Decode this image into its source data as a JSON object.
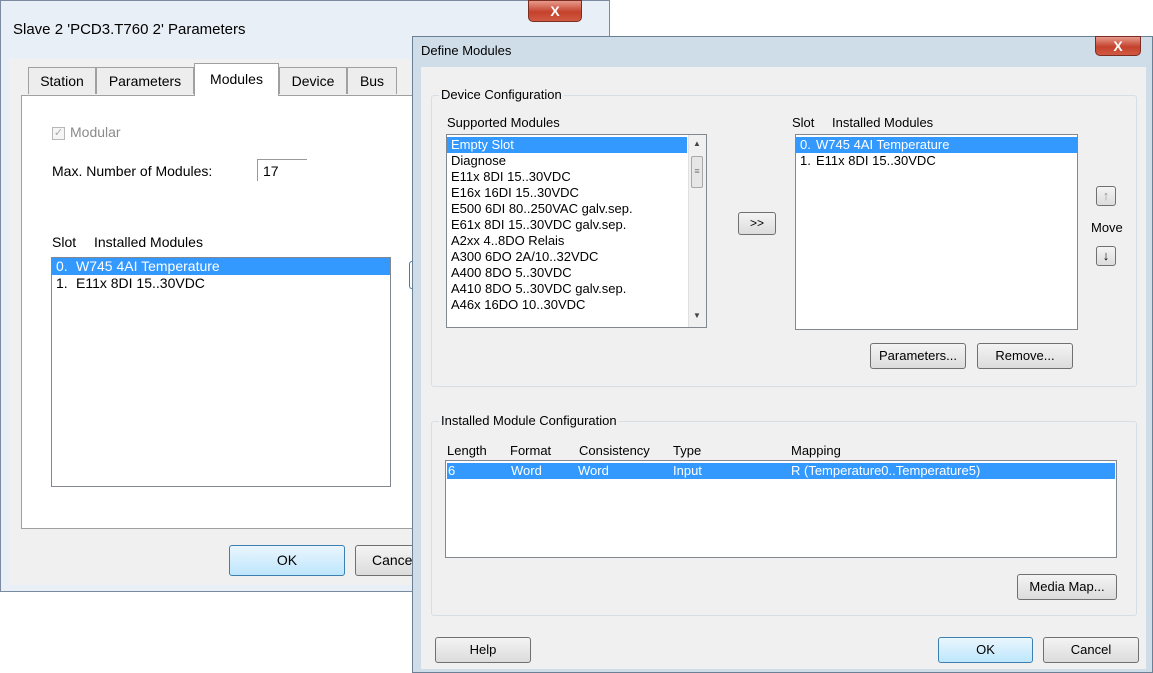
{
  "back_dialog": {
    "title": "Slave 2 'PCD3.T760 2' Parameters",
    "close_label": "X",
    "tabs": [
      {
        "label": "Station"
      },
      {
        "label": "Parameters"
      },
      {
        "label": "Modules"
      },
      {
        "label": "Device"
      },
      {
        "label": "Bus"
      }
    ],
    "active_tab": "Modules",
    "modular_label": "Modular",
    "modular_checked": true,
    "max_modules_label": "Max. Number of Modules:",
    "max_modules_value": "17",
    "slot_header": "Slot",
    "installed_header": "Installed Modules",
    "installed_modules": [
      {
        "slot": "0.",
        "name": "W745 4AI Temperature",
        "selected": true
      },
      {
        "slot": "1.",
        "name": "E11x 8DI 15..30VDC",
        "selected": false
      }
    ],
    "ok_label": "OK",
    "cancel_label": "Cancel"
  },
  "front_dialog": {
    "title": "Define Modules",
    "close_label": "X",
    "device_config_label": "Device Configuration",
    "supported_label": "Supported Modules",
    "supported_modules": [
      "Empty Slot",
      "Diagnose",
      "E11x 8DI 15..30VDC",
      "E16x 16DI 15..30VDC",
      "E500 6DI 80..250VAC galv.sep.",
      "E61x 8DI 15..30VDC galv.sep.",
      "A2xx 4..8DO Relais",
      "A300 6DO 2A/10..32VDC",
      "A400 8DO 5..30VDC",
      "A410 8DO 5..30VDC galv.sep.",
      "A46x 16DO 10..30VDC"
    ],
    "supported_selected_index": 0,
    "add_label": ">>",
    "slot_header": "Slot",
    "installed_header": "Installed Modules",
    "installed_modules": [
      {
        "slot": "0.",
        "name": "W745 4AI Temperature",
        "selected": true
      },
      {
        "slot": "1.",
        "name": "E11x 8DI 15..30VDC",
        "selected": false
      }
    ],
    "move_label": "Move",
    "move_up_icon": "arrow-up-icon",
    "move_down_icon": "arrow-down-icon",
    "parameters_label": "Parameters...",
    "remove_label": "Remove...",
    "installed_config_label": "Installed Module Configuration",
    "config_columns": [
      "Length",
      "Format",
      "Consistency",
      "Type",
      "Mapping"
    ],
    "config_rows": [
      {
        "length": "6",
        "format": "Word",
        "consistency": "Word",
        "type": "Input",
        "mapping": "R (Temperature0..Temperature5)",
        "selected": true
      }
    ],
    "media_map_label": "Media Map...",
    "help_label": "Help",
    "ok_label": "OK",
    "cancel_label": "Cancel"
  },
  "colors": {
    "selection": "#3399ff",
    "close_button": "#c4422c",
    "window_frame": "#cfdde9"
  }
}
